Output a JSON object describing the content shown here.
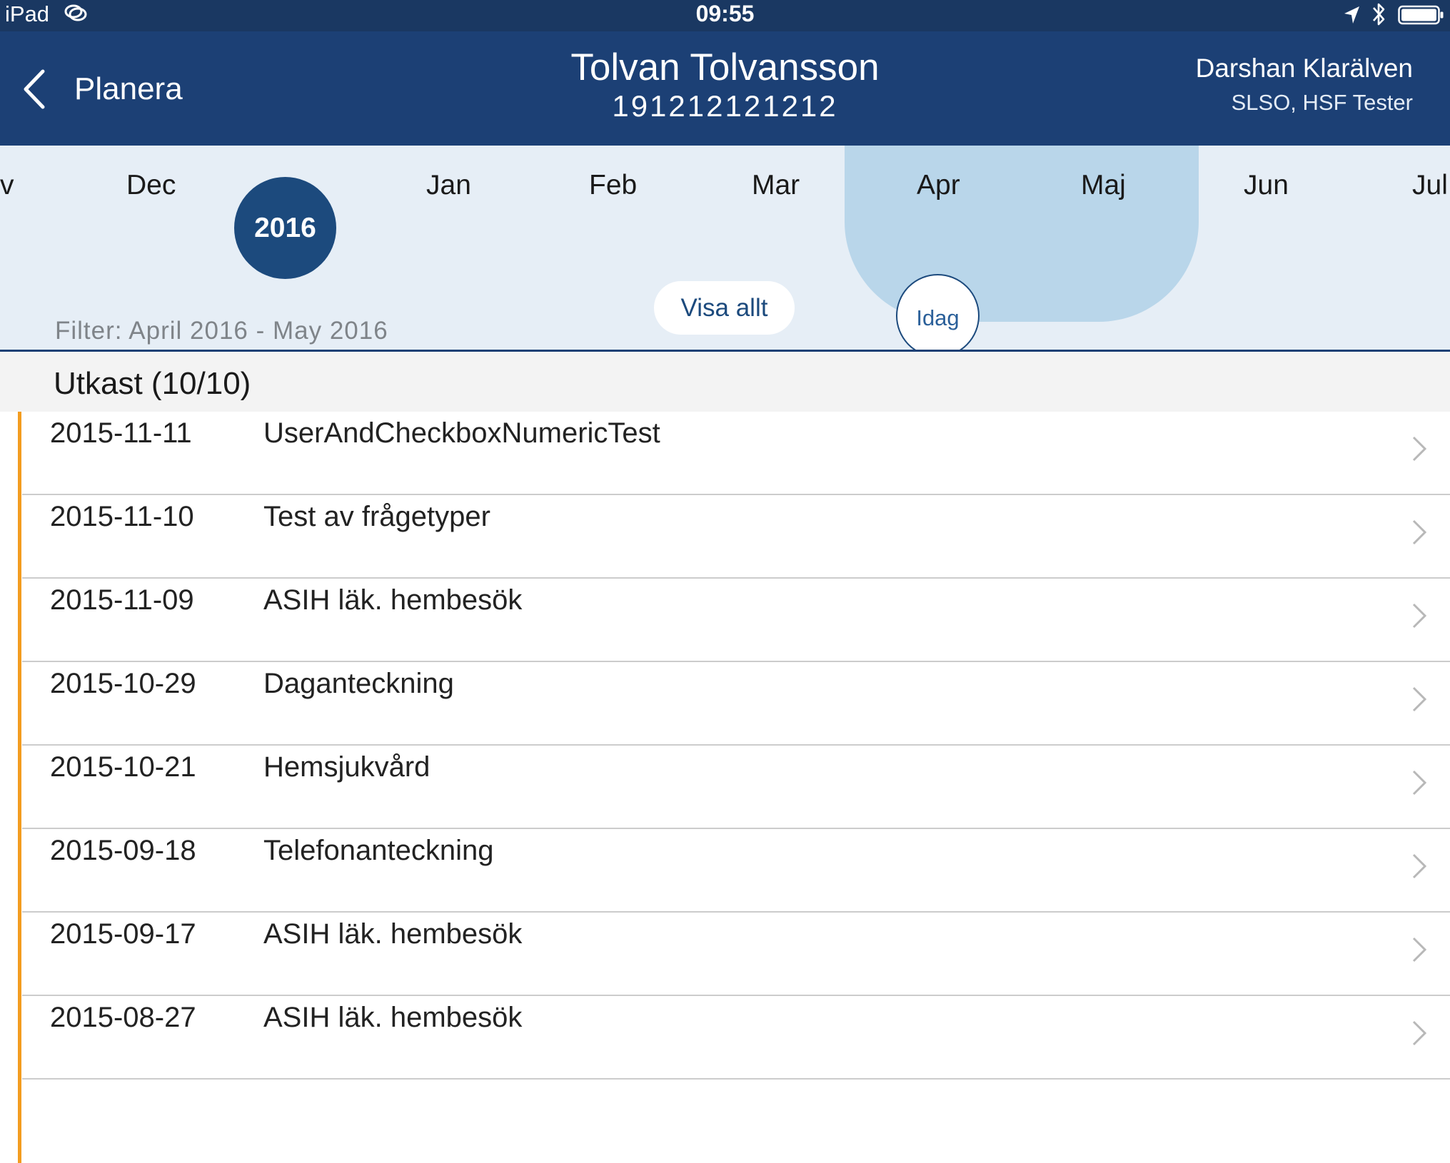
{
  "status_bar": {
    "device": "iPad",
    "time": "09:55",
    "icons": [
      "link-icon",
      "location-arrow-icon",
      "bluetooth-icon",
      "battery-icon"
    ]
  },
  "nav": {
    "back_label": "Planera",
    "patient_name": "Tolvan Tolvansson",
    "patient_id": "191212121212",
    "user_name": "Darshan Klarälven",
    "user_role": "SLSO, HSF Tester"
  },
  "timeline": {
    "months": [
      "v",
      "Dec",
      "Jan",
      "Feb",
      "Mar",
      "Apr",
      "Maj",
      "Jun",
      "Jul"
    ],
    "selected_months": [
      "Apr",
      "Maj"
    ],
    "year": "2016",
    "show_all_label": "Visa allt",
    "today_label": "Idag",
    "filter_text": "Filter: April 2016 - May 2016"
  },
  "section": {
    "title": "Utkast (10/10)"
  },
  "rows": [
    {
      "date": "2015-11-11",
      "title": "UserAndCheckboxNumericTest"
    },
    {
      "date": "2015-11-10",
      "title": "Test av frågetyper"
    },
    {
      "date": "2015-11-09",
      "title": "ASIH läk. hembesök"
    },
    {
      "date": "2015-10-29",
      "title": "Daganteckning"
    },
    {
      "date": "2015-10-21",
      "title": "Hemsjukvård"
    },
    {
      "date": "2015-09-18",
      "title": "Telefonanteckning"
    },
    {
      "date": "2015-09-17",
      "title": "ASIH läk. hembesök"
    },
    {
      "date": "2015-08-27",
      "title": "ASIH läk. hembesök"
    }
  ],
  "colors": {
    "status_bar": "#1a3862",
    "nav_bar": "#1c4075",
    "timeline_bg": "#e6eef6",
    "range_highlight": "#b9d6ea",
    "accent": "#1c4a7d",
    "draft_marker": "#f39c1f"
  }
}
